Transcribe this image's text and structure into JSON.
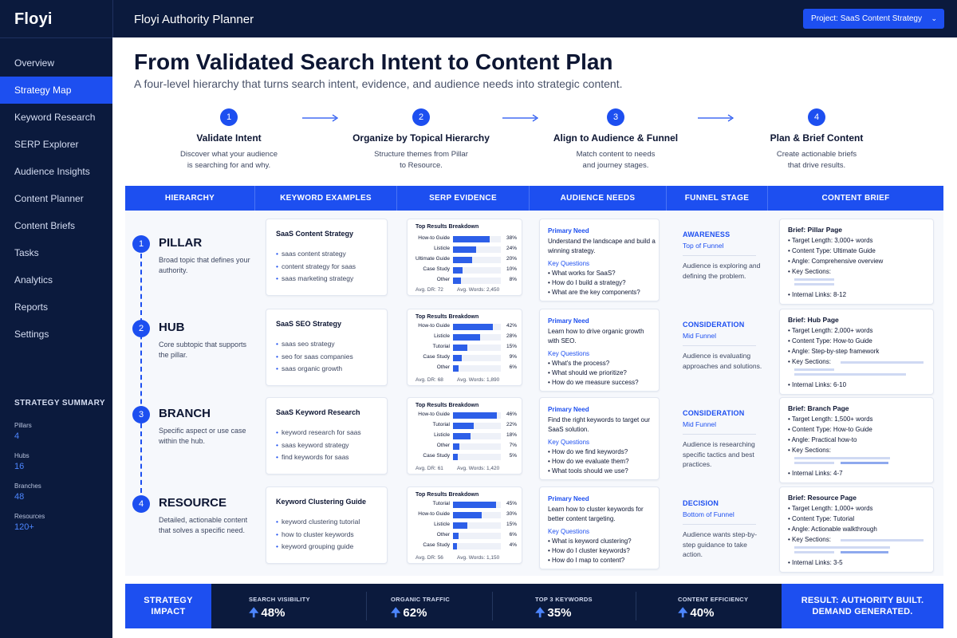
{
  "app": {
    "logo": "Floyi",
    "title": "Floyi Authority Planner",
    "project_button": "Project: SaaS Content Strategy"
  },
  "nav": [
    "Overview",
    "Strategy Map",
    "Keyword Research",
    "SERP Explorer",
    "Audience Insights",
    "Content Planner",
    "Content Briefs",
    "Tasks",
    "Analytics",
    "Reports",
    "Settings"
  ],
  "nav_active": "Strategy Map",
  "summary": {
    "title": "STRATEGY SUMMARY",
    "items": [
      {
        "label": "Pillars",
        "value": "4"
      },
      {
        "label": "Hubs",
        "value": "16"
      },
      {
        "label": "Branches",
        "value": "48"
      },
      {
        "label": "Resources",
        "value": "120+"
      }
    ]
  },
  "header": {
    "title": "From Validated Search Intent to Content Plan",
    "subtitle": "A four-level hierarchy that turns search intent, evidence, and audience needs into strategic content."
  },
  "steps": [
    {
      "num": "1",
      "title": "Validate Intent",
      "desc1": "Discover what your audience",
      "desc2": "is searching for and why."
    },
    {
      "num": "2",
      "title": "Organize by Topical Hierarchy",
      "desc1": "Structure themes from Pillar",
      "desc2": "to Resource."
    },
    {
      "num": "3",
      "title": "Align to Audience & Funnel",
      "desc1": "Match content to needs",
      "desc2": "and journey stages."
    },
    {
      "num": "4",
      "title": "Plan & Brief Content",
      "desc1": "Create actionable briefs",
      "desc2": "that drive results."
    }
  ],
  "columns": [
    "HIERARCHY",
    "KEYWORD EXAMPLES",
    "SERP EVIDENCE",
    "AUDIENCE NEEDS",
    "FUNNEL STAGE",
    "CONTENT BRIEF"
  ],
  "levels": [
    {
      "num": "1",
      "name": "PILLAR",
      "desc": "Broad topic that defines your authority.",
      "kw_title": "SaaS Content Strategy",
      "keywords": [
        "saas content strategy",
        "content strategy for saas",
        "saas marketing strategy"
      ],
      "serp": {
        "title": "Top Results Breakdown",
        "rows": [
          {
            "label": "How-to Guide",
            "pct": "38%",
            "value": 38
          },
          {
            "label": "Listicle",
            "pct": "24%",
            "value": 24
          },
          {
            "label": "Ultimate Guide",
            "pct": "20%",
            "value": 20
          },
          {
            "label": "Case Study",
            "pct": "10%",
            "value": 10
          },
          {
            "label": "Other",
            "pct": "8%",
            "value": 8
          }
        ],
        "dr": "Avg. DR: 72",
        "words": "Avg. Words: 2,450"
      },
      "audience": {
        "need_label": "Primary Need",
        "need": "Understand the landscape and build a winning strategy.",
        "q_label": "Key Questions",
        "questions": [
          "What works for SaaS?",
          "How do I build a strategy?",
          "What are the key components?"
        ]
      },
      "funnel": {
        "stage": "AWARENESS",
        "sub": "Top of Funnel",
        "desc": "Audience is exploring and defining the problem."
      },
      "brief": {
        "title": "Brief: Pillar Page",
        "length": "Target Length:  3,000+ words",
        "type": "Content Type:  Ultimate Guide",
        "angle": "Angle:  Comprehensive overview",
        "sections": "Key Sections:",
        "links": "Internal Links:  8-12"
      }
    },
    {
      "num": "2",
      "name": "HUB",
      "desc": "Core subtopic that supports the pillar.",
      "kw_title": "SaaS SEO Strategy",
      "keywords": [
        "saas seo strategy",
        "seo for saas companies",
        "saas organic growth"
      ],
      "serp": {
        "title": "Top Results Breakdown",
        "rows": [
          {
            "label": "How-to Guide",
            "pct": "42%",
            "value": 42
          },
          {
            "label": "Listicle",
            "pct": "28%",
            "value": 28
          },
          {
            "label": "Tutorial",
            "pct": "15%",
            "value": 15
          },
          {
            "label": "Case Study",
            "pct": "9%",
            "value": 9
          },
          {
            "label": "Other",
            "pct": "6%",
            "value": 6
          }
        ],
        "dr": "Avg. DR: 68",
        "words": "Avg. Words: 1,890"
      },
      "audience": {
        "need_label": "Primary Need",
        "need": "Learn how to drive organic growth with SEO.",
        "q_label": "Key Questions",
        "questions": [
          "What's the process?",
          "What should we prioritize?",
          "How do we measure success?"
        ]
      },
      "funnel": {
        "stage": "CONSIDERATION",
        "sub": "Mid Funnel",
        "desc": "Audience is evaluating approaches and solutions."
      },
      "brief": {
        "title": "Brief: Hub Page",
        "length": "Target Length:  2,000+ words",
        "type": "Content Type:  How-to Guide",
        "angle": "Angle:  Step-by-step framework",
        "sections": "Key Sections:",
        "links": "Internal Links:  6-10"
      }
    },
    {
      "num": "3",
      "name": "BRANCH",
      "desc": "Specific aspect or use case within the hub.",
      "kw_title": "SaaS Keyword Research",
      "keywords": [
        "keyword research for saas",
        "saas keyword strategy",
        "find keywords for saas"
      ],
      "serp": {
        "title": "Top Results Breakdown",
        "rows": [
          {
            "label": "How-to Guide",
            "pct": "46%",
            "value": 46
          },
          {
            "label": "Tutorial",
            "pct": "22%",
            "value": 22
          },
          {
            "label": "Listicle",
            "pct": "18%",
            "value": 18
          },
          {
            "label": "Other",
            "pct": "7%",
            "value": 7
          },
          {
            "label": "Case Study",
            "pct": "5%",
            "value": 5
          }
        ],
        "dr": "Avg. DR: 61",
        "words": "Avg. Words: 1,420"
      },
      "audience": {
        "need_label": "Primary Need",
        "need": "Find the right keywords to target our SaaS solution.",
        "q_label": "Key Questions",
        "questions": [
          "How do we find keywords?",
          "How do we evaluate them?",
          "What tools should we use?"
        ]
      },
      "funnel": {
        "stage": "CONSIDERATION",
        "sub": "Mid Funnel",
        "desc": "Audience is researching specific tactics and best practices."
      },
      "brief": {
        "title": "Brief: Branch Page",
        "length": "Target Length:  1,500+ words",
        "type": "Content Type:  How-to Guide",
        "angle": "Angle:  Practical how-to",
        "sections": "Key Sections:",
        "links": "Internal Links:  4-7"
      }
    },
    {
      "num": "4",
      "name": "RESOURCE",
      "desc": "Detailed, actionable content that solves a specific need.",
      "kw_title": "Keyword Clustering Guide",
      "keywords": [
        "keyword clustering tutorial",
        "how to cluster keywords",
        "keyword grouping guide"
      ],
      "serp": {
        "title": "Top Results Breakdown",
        "rows": [
          {
            "label": "Tutorial",
            "pct": "45%",
            "value": 45
          },
          {
            "label": "How-to Guide",
            "pct": "30%",
            "value": 30
          },
          {
            "label": "Listicle",
            "pct": "15%",
            "value": 15
          },
          {
            "label": "Other",
            "pct": "6%",
            "value": 6
          },
          {
            "label": "Case Study",
            "pct": "4%",
            "value": 4
          }
        ],
        "dr": "Avg. DR: 56",
        "words": "Avg. Words: 1,150"
      },
      "audience": {
        "need_label": "Primary Need",
        "need": "Learn how to cluster keywords for better content targeting.",
        "q_label": "Key Questions",
        "questions": [
          "What is keyword clustering?",
          "How do I cluster keywords?",
          "How do I map to content?"
        ]
      },
      "funnel": {
        "stage": "DECISION",
        "sub": "Bottom of Funnel",
        "desc": "Audience wants step-by-step guidance to take action."
      },
      "brief": {
        "title": "Brief: Resource Page",
        "length": "Target Length:  1,000+ words",
        "type": "Content Type:  Tutorial",
        "angle": "Angle:  Actionable walkthrough",
        "sections": "Key Sections:",
        "links": "Internal Links:  3-5"
      }
    }
  ],
  "impact": {
    "label_line1": "STRATEGY",
    "label_line2": "IMPACT",
    "metrics": [
      {
        "label": "SEARCH VISIBILITY",
        "value": "48%"
      },
      {
        "label": "ORGANIC TRAFFIC",
        "value": "62%"
      },
      {
        "label": "TOP 3 KEYWORDS",
        "value": "35%"
      },
      {
        "label": "CONTENT EFFICIENCY",
        "value": "40%"
      }
    ],
    "result_line1": "RESULT: AUTHORITY BUILT.",
    "result_line2": "DEMAND GENERATED."
  },
  "colors": {
    "accent": "#1d4ff0",
    "navy": "#0b1a3d",
    "light_bg": "#f6f8fc"
  },
  "icons": {
    "project_dropdown": "chevron-down-icon",
    "step_arrow": "arrow-right-icon",
    "metric_arrow": "arrow-up-icon"
  }
}
